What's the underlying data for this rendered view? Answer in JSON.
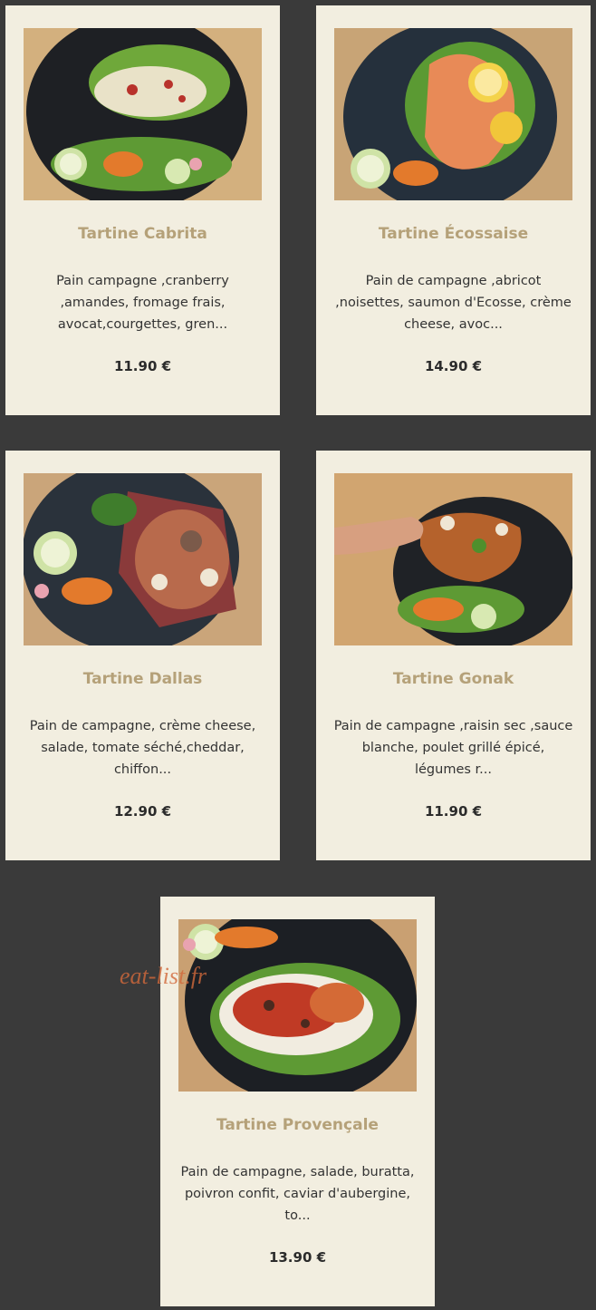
{
  "menu": {
    "items": [
      {
        "name": "Tartine Cabrita",
        "description": "Pain campagne ,cranberry ,amandes, fromage frais, avocat,courgettes, gren...",
        "price": "11.90 €"
      },
      {
        "name": "Tartine Écossaise",
        "description": "Pain de campagne ,abricot ,noisettes, saumon d'Ecosse, crème cheese, avoc...",
        "price": "14.90 €"
      },
      {
        "name": "Tartine Dallas",
        "description": "Pain de campagne, crème cheese, salade, tomate séché,cheddar, chiffon...",
        "price": "12.90 €"
      },
      {
        "name": "Tartine Gonak",
        "description": "Pain de campagne ,raisin sec ,sauce blanche, poulet grillé épicé, légumes r...",
        "price": "11.90 €"
      },
      {
        "name": "Tartine Provençale",
        "description": "Pain de campagne, salade, buratta, poivron confit, caviar d'aubergine, to...",
        "price": "13.90 €"
      }
    ]
  },
  "watermark": "eat-list.fr",
  "colors": {
    "background": "#3a3a3a",
    "card": "#f2eee0",
    "title": "#b5a179",
    "text": "#333333",
    "watermark": "#d2693b"
  }
}
